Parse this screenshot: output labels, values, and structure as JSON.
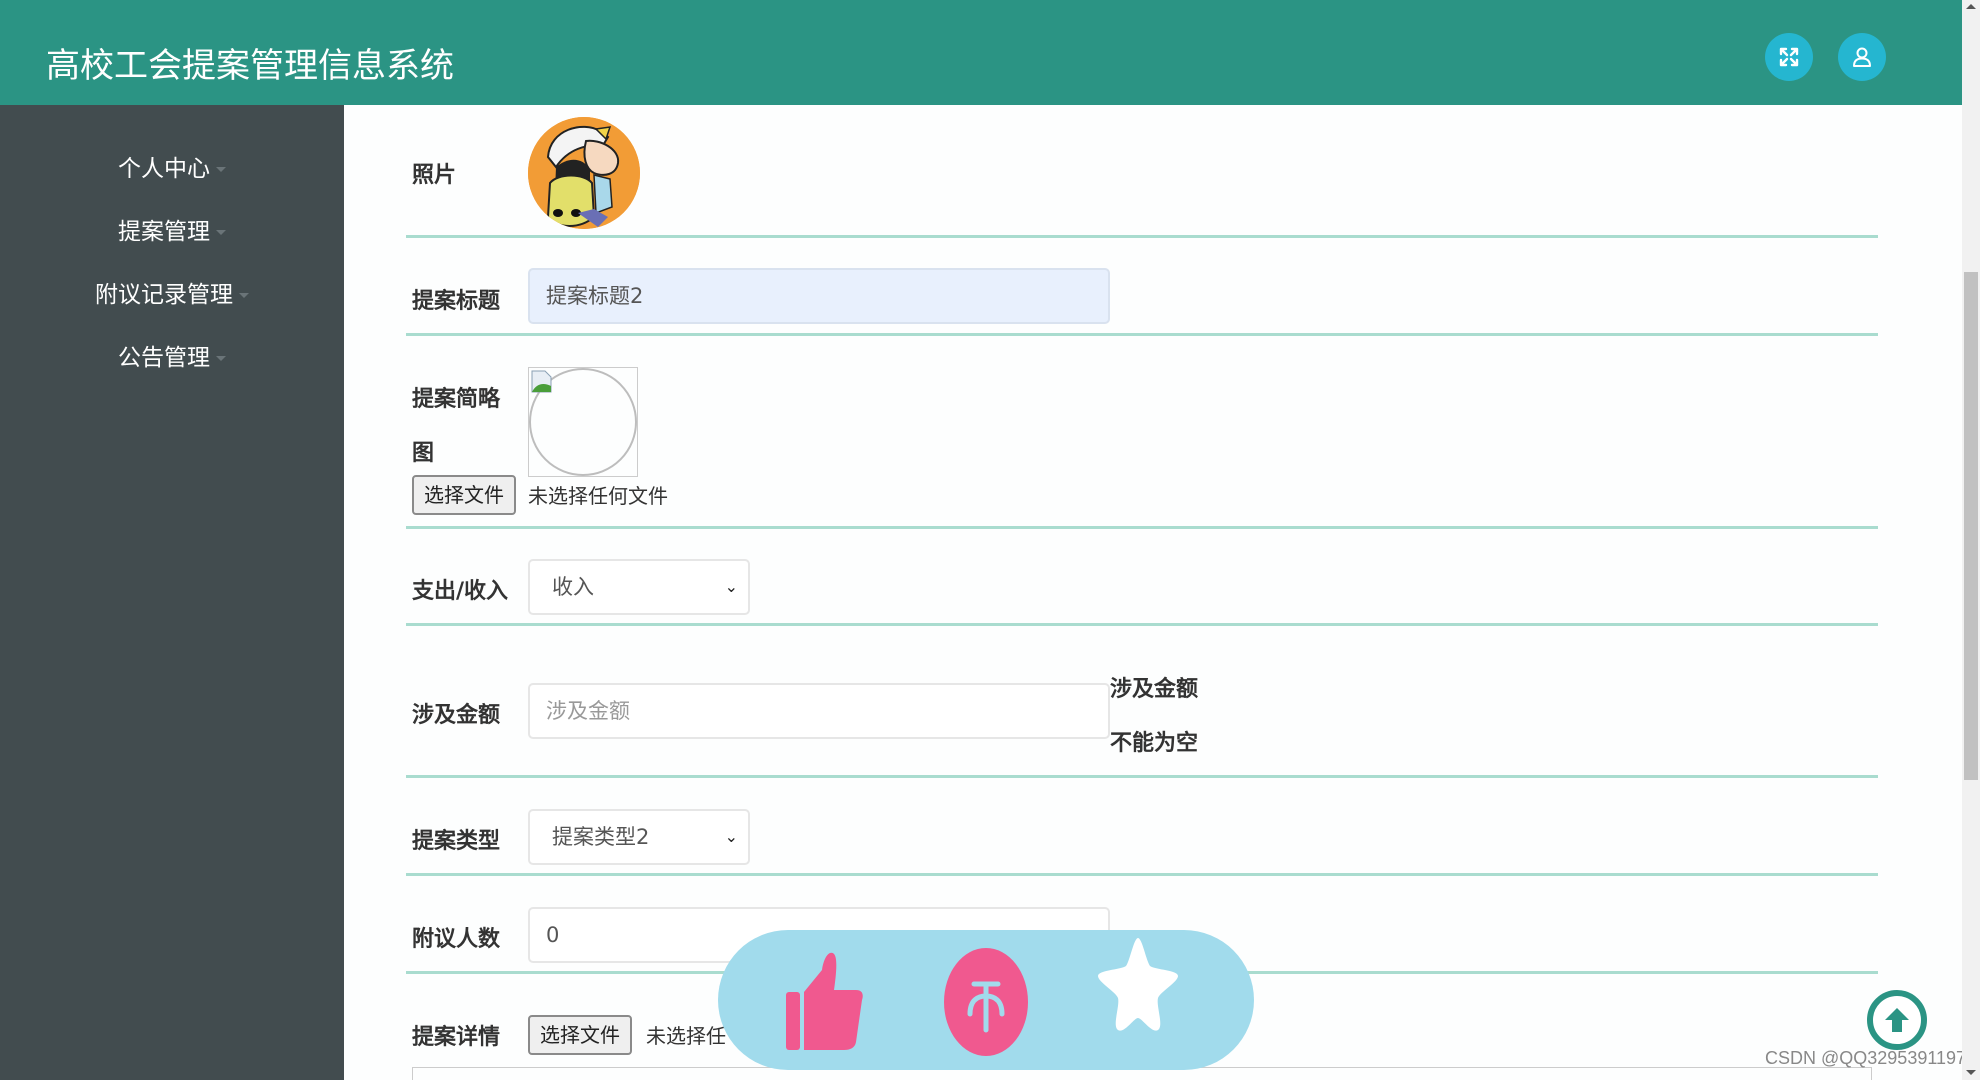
{
  "header": {
    "app_title": "高校工会提案管理信息系统",
    "fullscreen_icon": "fullscreen-expand-icon",
    "user_icon": "user-icon"
  },
  "sidebar": {
    "items": [
      {
        "label": "个人中心",
        "icon": "caret-down-icon"
      },
      {
        "label": "提案管理",
        "icon": "caret-down-icon"
      },
      {
        "label": "附议记录管理",
        "icon": "caret-down-icon"
      },
      {
        "label": "公告管理",
        "icon": "caret-down-icon"
      }
    ]
  },
  "form": {
    "photo": {
      "label": "照片"
    },
    "title": {
      "label": "提案标题",
      "value": "提案标题2"
    },
    "thumbnail": {
      "label_line1": "提案简略",
      "label_line2": "图",
      "file_button": "选择文件",
      "file_status": "未选择任何文件"
    },
    "expense_income": {
      "label": "支出/收入",
      "selected": "收入"
    },
    "amount": {
      "label": "涉及金额",
      "placeholder": "涉及金额",
      "value": "",
      "error_line1": "涉及金额",
      "error_line2": "不能为空"
    },
    "proposal_type": {
      "label": "提案类型",
      "selected": "提案类型2"
    },
    "supporter_count": {
      "label": "附议人数",
      "value": "0"
    },
    "details": {
      "label": "提案详情",
      "file_button": "选择文件",
      "file_status": "未选择任"
    }
  },
  "floating_bar": {
    "buttons": [
      {
        "icon": "thumbs-up-icon"
      },
      {
        "icon": "coin-icon"
      },
      {
        "icon": "star-icon"
      }
    ],
    "colors": {
      "background": "#a1dbec",
      "accent": "#f0598f"
    }
  },
  "back_to_top": {
    "icon": "arrow-up-icon"
  },
  "watermark": "CSDN @QQ3295391197",
  "theme": {
    "primary": "#2b9484",
    "sidebar": "#424c4f",
    "divider": "#a9dccf",
    "header_button": "#25b6d0"
  }
}
